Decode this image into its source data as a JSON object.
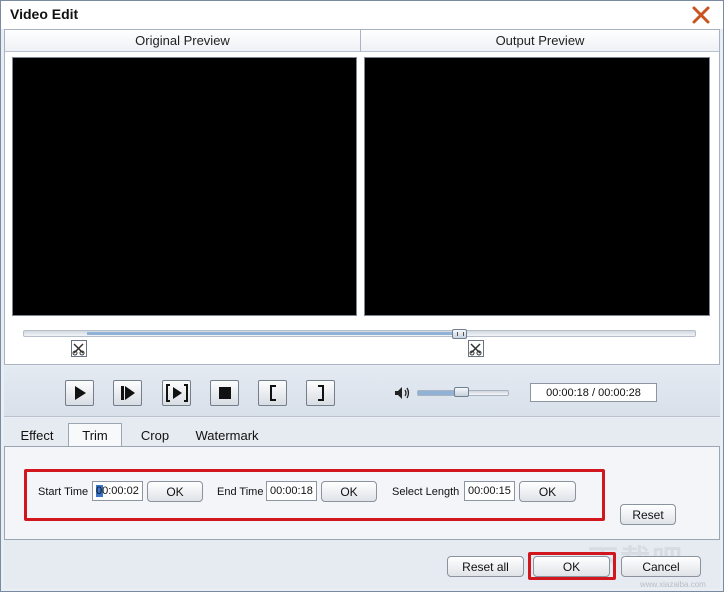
{
  "window": {
    "title": "Video Edit"
  },
  "preview": {
    "original_label": "Original Preview",
    "output_label": "Output Preview"
  },
  "playback": {
    "position_fraction": 0.65,
    "volume_fraction": 0.48,
    "time_display": "00:00:18 / 00:00:28"
  },
  "tabs": [
    {
      "label": "Effect",
      "active": false
    },
    {
      "label": "Trim",
      "active": true
    },
    {
      "label": "Crop",
      "active": false
    },
    {
      "label": "Watermark",
      "active": false
    }
  ],
  "trim": {
    "start_label": "Start Time",
    "start_value": "00:00:02",
    "start_ok": "OK",
    "end_label": "End Time",
    "end_value": "00:00:18",
    "end_ok": "OK",
    "length_label": "Select Length",
    "length_value": "00:00:15",
    "length_ok": "OK",
    "reset_label": "Reset"
  },
  "footer": {
    "reset_all": "Reset all",
    "ok": "OK",
    "cancel": "Cancel"
  },
  "watermark": {
    "text": "下载吧",
    "url": "www.xiazaiba.com"
  },
  "colors": {
    "highlight": "#d2161e",
    "accent": "#8fb2d6"
  }
}
